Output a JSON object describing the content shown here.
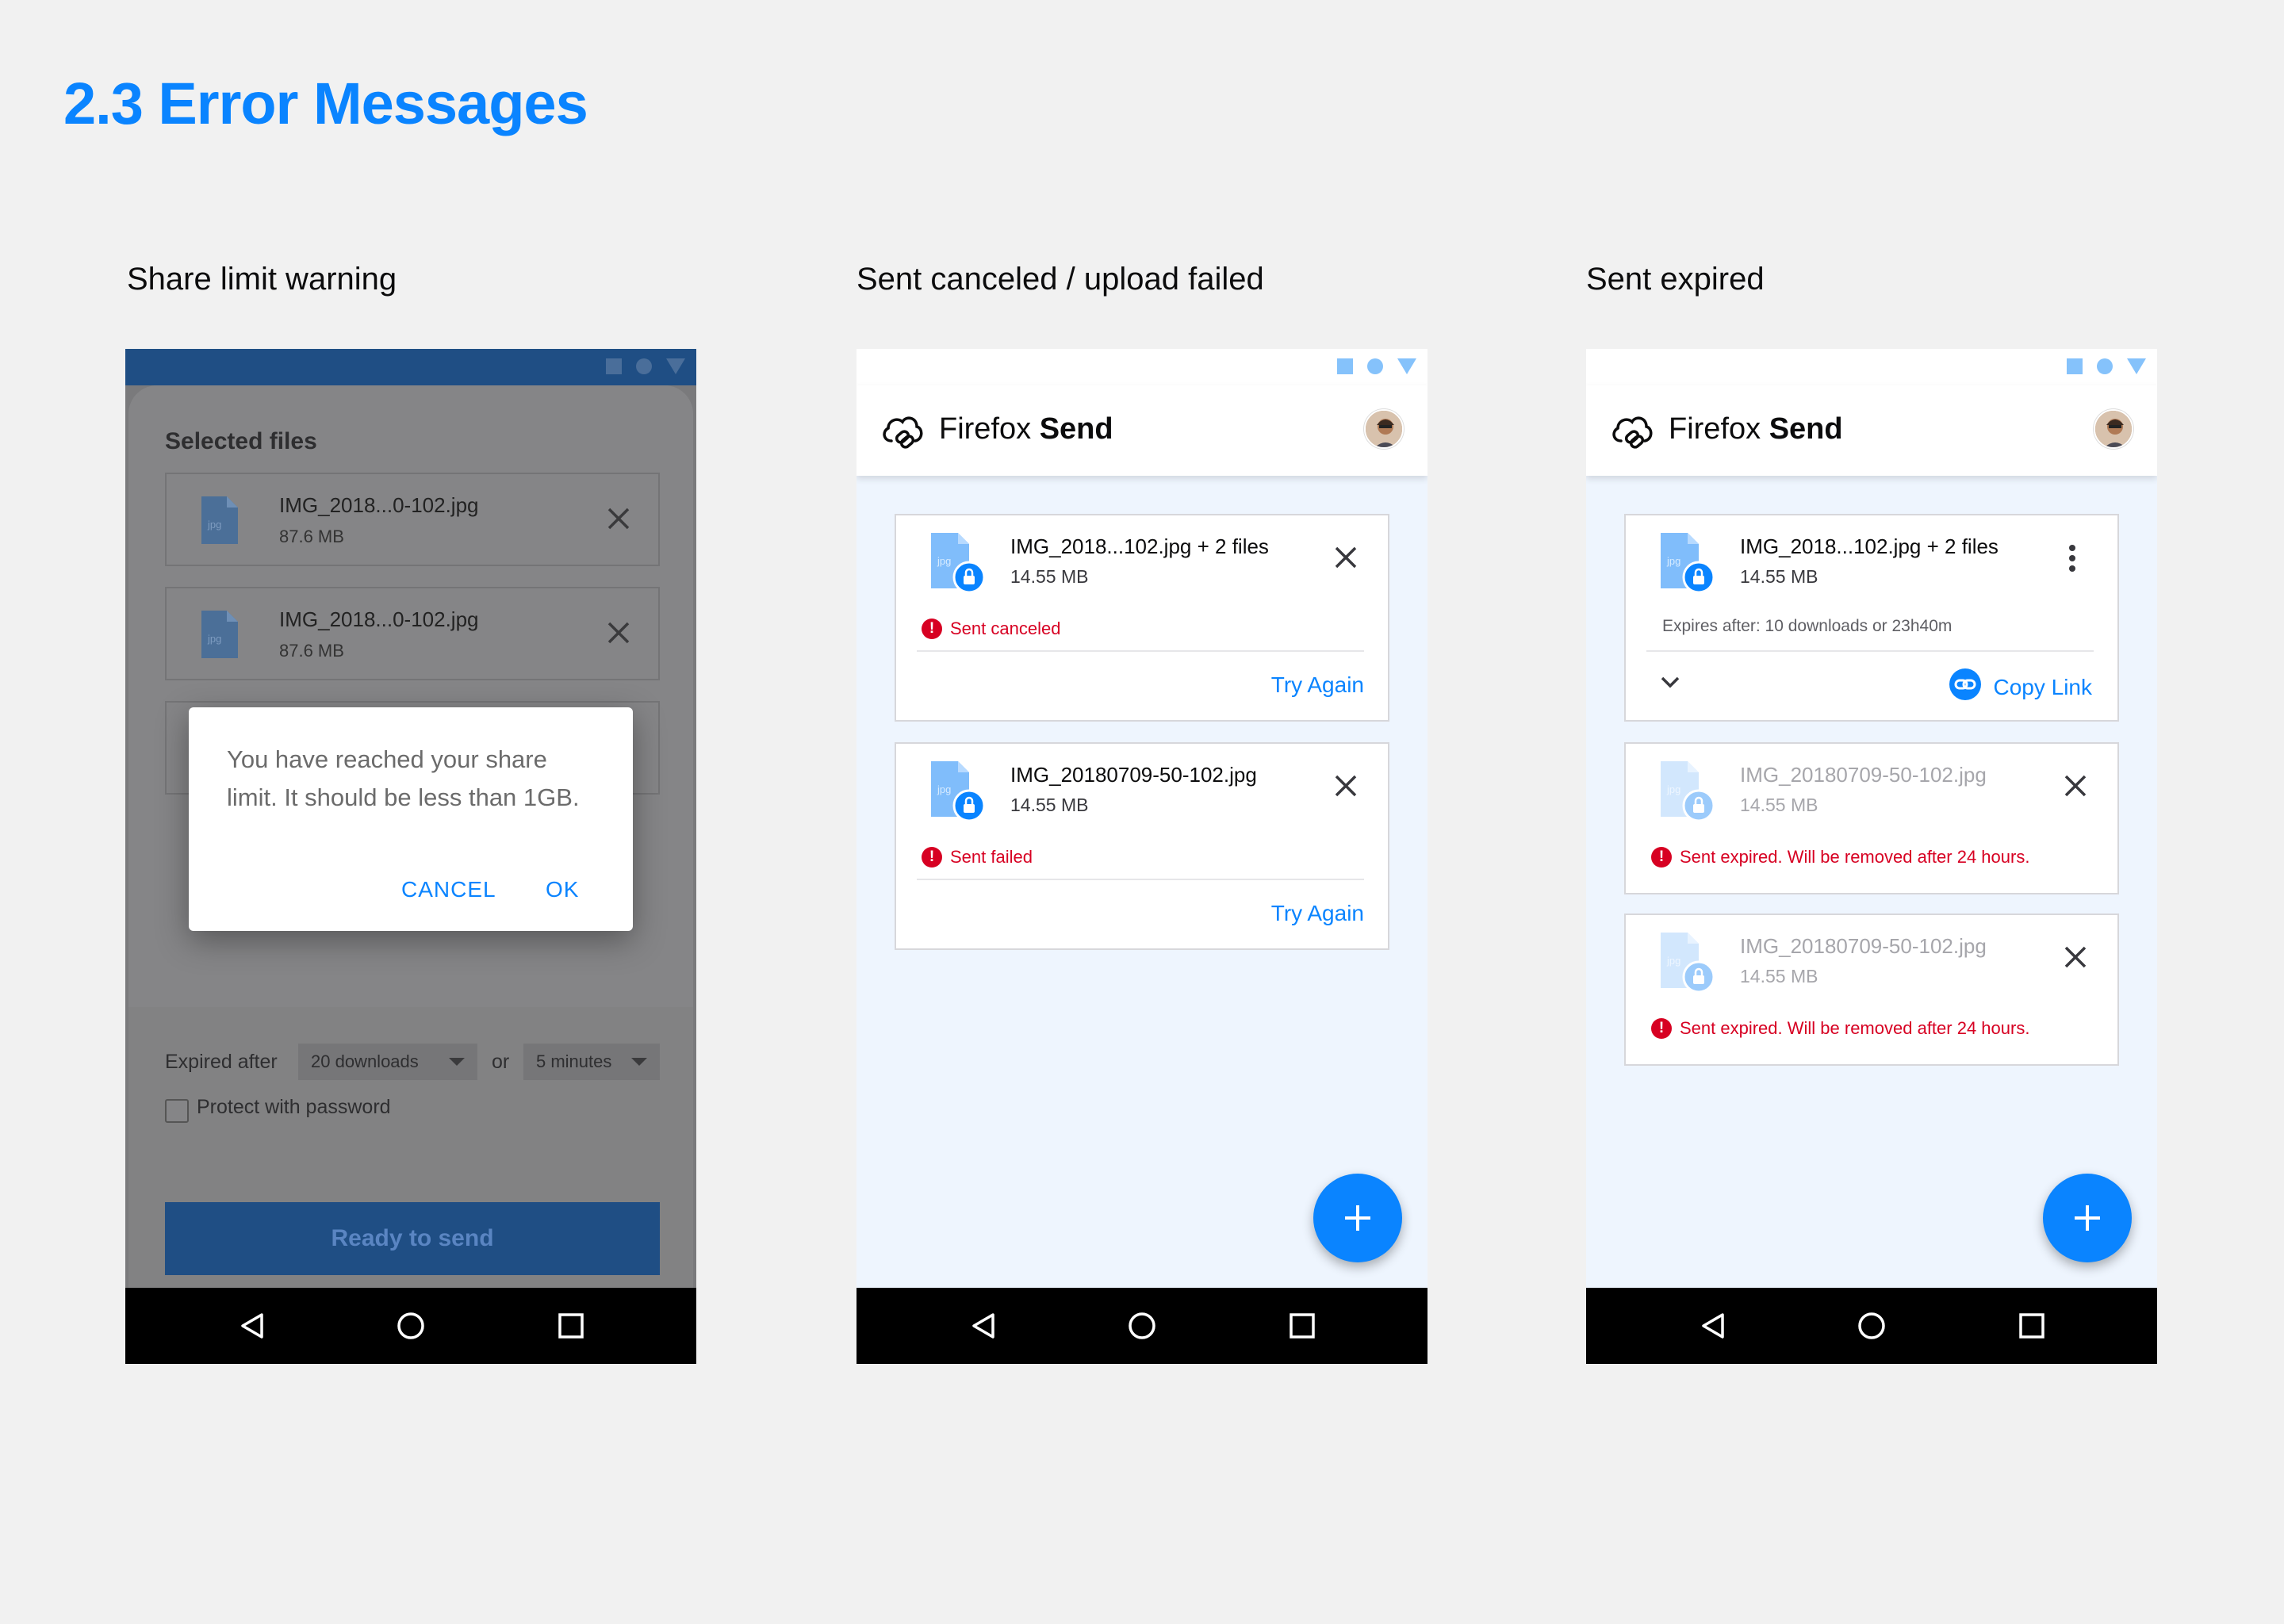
{
  "page": {
    "title": "2.3 Error Messages"
  },
  "colors": {
    "accent": "#0a84ff",
    "error": "#d70022",
    "dimmed_primary": "#1f4e84"
  },
  "sections": [
    {
      "label": "Share limit warning"
    },
    {
      "label": "Sent canceled / upload failed"
    },
    {
      "label": "Sent expired"
    }
  ],
  "share_limit": {
    "heading": "Selected files",
    "files": [
      {
        "name": "IMG_2018...0-102.jpg",
        "size": "87.6 MB",
        "icon": "jpg-file-icon"
      },
      {
        "name": "IMG_2018...0-102.jpg",
        "size": "87.6 MB",
        "icon": "jpg-file-icon"
      }
    ],
    "expired_label": "Expired after",
    "downloads_select": "20 downloads",
    "or_label": "or",
    "time_select": "5 minutes",
    "password_label": "Protect with password",
    "send_button": "Ready to send",
    "dialog": {
      "message": "You have reached your share limit. It should be less than 1GB.",
      "cancel": "CANCEL",
      "ok": "OK"
    }
  },
  "app": {
    "brand_light": "Firefox ",
    "brand_bold": "Send",
    "logo_icon": "cloud-link-icon",
    "avatar_icon": "user-avatar"
  },
  "canceled_failed": {
    "cards": [
      {
        "name": "IMG_2018...102.jpg + 2 files",
        "size": "14.55 MB",
        "error": "Sent canceled",
        "action": "Try Again"
      },
      {
        "name": "IMG_20180709-50-102.jpg",
        "size": "14.55 MB",
        "error": "Sent failed",
        "action": "Try Again"
      }
    ]
  },
  "expired": {
    "active": {
      "name": "IMG_2018...102.jpg + 2 files",
      "size": "14.55 MB",
      "expires": "Expires after: 10 downloads or 23h40m",
      "copy_link": "Copy Link"
    },
    "cards": [
      {
        "name": "IMG_20180709-50-102.jpg",
        "size": "14.55 MB",
        "error": "Sent expired. Will be removed after 24 hours."
      },
      {
        "name": "IMG_20180709-50-102.jpg",
        "size": "14.55 MB",
        "error": "Sent expired. Will be removed after 24 hours."
      }
    ]
  }
}
